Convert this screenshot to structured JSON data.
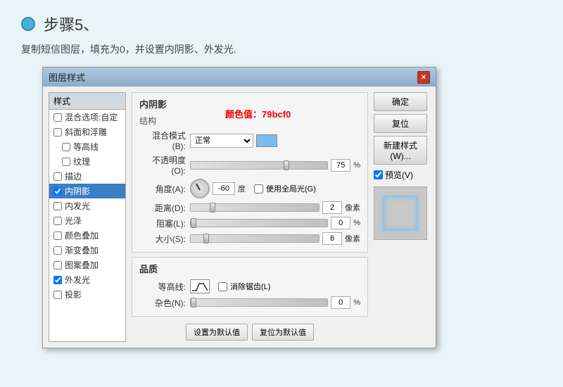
{
  "page": {
    "step_circle_color": "#4ab0d8",
    "step_title": "步骤5、",
    "description": "复制短信图层，填充为0，并设置内阴影、外发光."
  },
  "dialog": {
    "title": "图层样式",
    "close_btn": "×",
    "styles_header": "样式",
    "style_items": [
      {
        "label": "混合选项:自定",
        "checked": false,
        "active": false
      },
      {
        "label": "斜面和浮雕",
        "checked": false,
        "active": false
      },
      {
        "label": "等高线",
        "checked": false,
        "active": false
      },
      {
        "label": "纹理",
        "checked": false,
        "active": false
      },
      {
        "label": "描边",
        "checked": false,
        "active": false
      },
      {
        "label": "内阴影",
        "checked": true,
        "active": true
      },
      {
        "label": "内发光",
        "checked": false,
        "active": false
      },
      {
        "label": "光泽",
        "checked": false,
        "active": false
      },
      {
        "label": "颜色叠加",
        "checked": false,
        "active": false
      },
      {
        "label": "渐变叠加",
        "checked": false,
        "active": false
      },
      {
        "label": "图案叠加",
        "checked": false,
        "active": false
      },
      {
        "label": "外发光",
        "checked": true,
        "active": false
      },
      {
        "label": "投影",
        "checked": false,
        "active": false
      }
    ],
    "inner_shadow": {
      "section_title": "内阴影",
      "structure_title": "结构",
      "color_annotation": "颜色值：79bcf0",
      "blend_mode_label": "混合模式(B):",
      "blend_mode_value": "正常",
      "opacity_label": "不透明度(O):",
      "opacity_value": "75",
      "opacity_unit": "%",
      "angle_label": "角度(A):",
      "angle_value": "-60",
      "angle_unit": "度",
      "use_global_light_label": "使用全局光(G)",
      "distance_label": "距离(D):",
      "distance_value": "2",
      "distance_unit": "像素",
      "choke_label": "阻塞(L):",
      "choke_value": "0",
      "choke_unit": "%",
      "size_label": "大小(S):",
      "size_value": "6",
      "size_unit": "像素",
      "quality_title": "品质",
      "contour_label": "等高线:",
      "anti_alias_label": "消除锯齿(L)",
      "noise_label": "杂色(N):",
      "noise_value": "0",
      "noise_unit": "%",
      "reset_btn": "设置为默认值",
      "default_btn": "复位为默认值"
    },
    "action_buttons": {
      "ok": "确定",
      "reset": "复位",
      "new_style": "新建样式(W)...",
      "preview_label": "预览(V)"
    }
  }
}
